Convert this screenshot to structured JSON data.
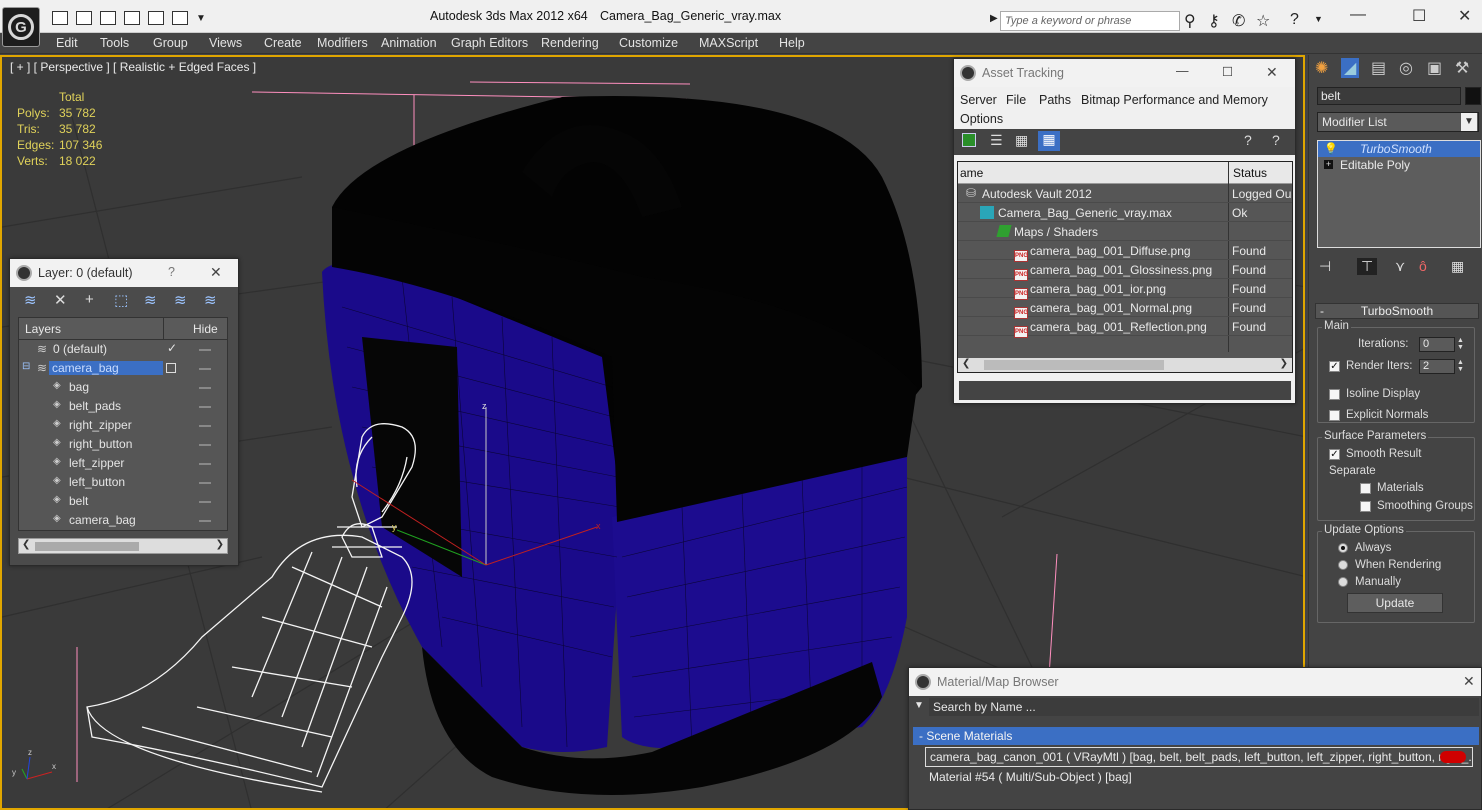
{
  "window": {
    "app_title": "Autodesk 3ds Max  2012 x64",
    "file_title": "Camera_Bag_Generic_vray.max",
    "search_placeholder": "Type a keyword or phrase",
    "minimize": "—",
    "maximize": "☐",
    "close": "✕"
  },
  "menu": [
    "Edit",
    "Tools",
    "Group",
    "Views",
    "Create",
    "Modifiers",
    "Animation",
    "Graph Editors",
    "Rendering",
    "Customize",
    "MAXScript",
    "Help"
  ],
  "viewport": {
    "label": "[ + ] [ Perspective ] [ Realistic + Edged Faces ]",
    "stats": {
      "header": "Total",
      "rows": [
        {
          "label": "Polys:",
          "value": "35 782"
        },
        {
          "label": "Tris:",
          "value": "35 782"
        },
        {
          "label": "Edges:",
          "value": "107 346"
        },
        {
          "label": "Verts:",
          "value": "18 022"
        }
      ]
    },
    "gizmo_z": "z",
    "gizmo_y": "y",
    "gizmo_x": "x",
    "axis_x": "x",
    "axis_y": "y",
    "axis_z": "z"
  },
  "layer_window": {
    "title": "Layer: 0 (default)",
    "help": "?",
    "close": "✕",
    "col_layers": "Layers",
    "col_hide": "Hide",
    "rows": [
      {
        "name": "0 (default)",
        "indent": 0
      },
      {
        "name": "camera_bag",
        "indent": 0
      },
      {
        "name": "bag",
        "indent": 1
      },
      {
        "name": "belt_pads",
        "indent": 1
      },
      {
        "name": "right_zipper",
        "indent": 1
      },
      {
        "name": "right_button",
        "indent": 1
      },
      {
        "name": "left_zipper",
        "indent": 1
      },
      {
        "name": "left_button",
        "indent": 1
      },
      {
        "name": "belt",
        "indent": 1
      },
      {
        "name": "camera_bag",
        "indent": 1
      }
    ],
    "check": "✓"
  },
  "asset_tracking": {
    "title": "Asset Tracking",
    "menu": [
      "Server",
      "File",
      "Paths",
      "Bitmap Performance and Memory",
      "Options"
    ],
    "col_name": "ame",
    "col_status": "Status",
    "rows": [
      {
        "name": "Autodesk Vault 2012",
        "status": "Logged Ou"
      },
      {
        "name": "Camera_Bag_Generic_vray.max",
        "status": "Ok"
      },
      {
        "name": "Maps / Shaders",
        "status": ""
      },
      {
        "name": "camera_bag_001_Diffuse.png",
        "status": "Found"
      },
      {
        "name": "camera_bag_001_Glossiness.png",
        "status": "Found"
      },
      {
        "name": "camera_bag_001_ior.png",
        "status": "Found"
      },
      {
        "name": "camera_bag_001_Normal.png",
        "status": "Found"
      },
      {
        "name": "camera_bag_001_Reflection.png",
        "status": "Found"
      }
    ],
    "png_tag": "PNG"
  },
  "command_panel": {
    "object_name": "belt",
    "modifier_list": "Modifier List",
    "stack": [
      "TurboSmooth",
      "Editable Poly"
    ],
    "rollout": "TurboSmooth",
    "main_group": "Main",
    "iterations_label": "Iterations:",
    "iterations_value": "0",
    "render_iters_label": "Render Iters:",
    "render_iters_value": "2",
    "isoline": "Isoline Display",
    "explicit_normals": "Explicit Normals",
    "surface_group": "Surface Parameters",
    "smooth_result": "Smooth Result",
    "separate": "Separate",
    "materials": "Materials",
    "smoothing_groups": "Smoothing Groups",
    "update_group": "Update Options",
    "always": "Always",
    "when_rendering": "When Rendering",
    "manually": "Manually",
    "update_button": "Update"
  },
  "material_browser": {
    "title": "Material/Map Browser",
    "search_placeholder": "Search by Name ...",
    "group": "- Scene Materials",
    "rows": [
      "camera_bag_canon_001  ( VRayMtl ) [bag, belt, belt_pads, left_button, left_zipper, right_button, right_...",
      "Material #54  ( Multi/Sub-Object ) [bag]"
    ]
  }
}
